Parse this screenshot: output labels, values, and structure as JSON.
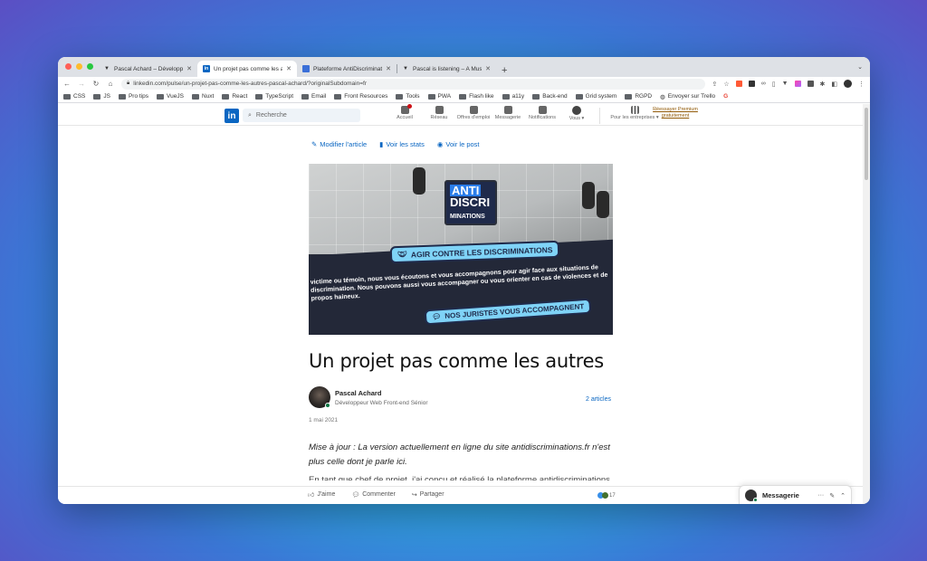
{
  "browser": {
    "tabs": [
      {
        "title": "Pascal Achard – Développeur fr",
        "icon": "vercel-triangle-icon",
        "active": false
      },
      {
        "title": "Un projet pas comme les autres",
        "icon": "linkedin-icon",
        "active": true
      },
      {
        "title": "Plateforme AntiDiscriminations",
        "icon": "site-icon",
        "active": false
      },
      {
        "title": "Pascal is listening – A Musical",
        "icon": "vercel-triangle-icon",
        "active": false
      }
    ],
    "new_tab": "+",
    "url": "linkedin.com/pulse/un-projet-pas-comme-les-autres-pascal-achard/?originalSubdomain=fr",
    "bookmarks": [
      "CSS",
      "JS",
      "Pro tips",
      "VueJS",
      "Nuxt",
      "React",
      "TypeScript",
      "Email",
      "Front Resources",
      "Tools",
      "PWA",
      "Flash like",
      "a11y",
      "Back-end",
      "Grid system",
      "RGPD",
      "Envoyer sur Trello",
      "G"
    ]
  },
  "linkedin": {
    "logo": "in",
    "search_placeholder": "Recherche",
    "nav": [
      {
        "label": "Accueil",
        "icon": "home-icon"
      },
      {
        "label": "Réseau",
        "icon": "network-icon"
      },
      {
        "label": "Offres d'emploi",
        "icon": "briefcase-icon"
      },
      {
        "label": "Messagerie",
        "icon": "message-icon"
      },
      {
        "label": "Notifications",
        "icon": "bell-icon"
      },
      {
        "label": "Vous ▾",
        "icon": "avatar-icon"
      },
      {
        "label": "Pour les entreprises ▾",
        "icon": "grid-icon"
      }
    ],
    "premium": "Réessayer Premium gratuitement",
    "edit_links": [
      "Modifier l'article",
      "Voir les stats",
      "Voir le post"
    ],
    "hero": {
      "logo_lines": [
        "ANTI",
        "DISCRI",
        "MINATIONS"
      ],
      "pill1": "AGIR CONTRE LES DISCRIMINATIONS",
      "text1": "victime ou témoin, nous vous écoutons et vous accompagnons pour agir face aux situations de discrimination. Nous pouvons aussi vous accompagner ou vous orienter en cas de violences et de propos haineux.",
      "pill2": "NOS JURISTES VOUS ACCOMPAGNENT"
    },
    "article": {
      "title": "Un projet pas comme les autres",
      "author_name": "Pascal Achard",
      "author_role": "Développeur Web Front-end Sénior",
      "articles_count": "2 articles",
      "date": "1 mai 2021",
      "paragraph": "Mise à jour : La version actuellement en ligne du site antidiscriminations.fr n'est plus celle dont je parle ici.",
      "next_line": "En tant que chef de projet, j'ai conçu et réalisé la plateforme antidiscriminations"
    },
    "footer": {
      "like": "J'aime",
      "comment": "Commenter",
      "share": "Partager",
      "reactions_count": "17",
      "messaging": "Messagerie"
    }
  }
}
